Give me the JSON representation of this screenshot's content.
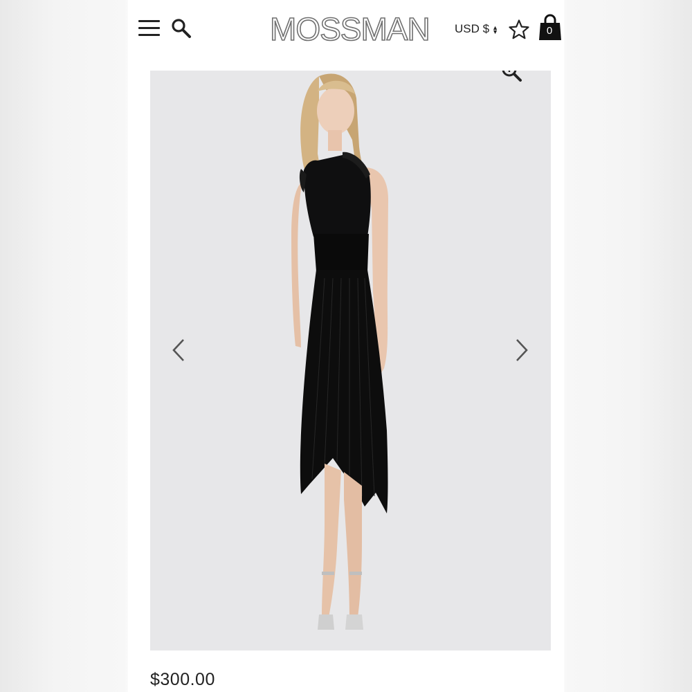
{
  "header": {
    "brand": "MOSSMAN",
    "currency_label": "USD $",
    "cart_count": "0",
    "icons": [
      "menu-icon",
      "search-icon",
      "star-icon",
      "bag-icon"
    ]
  },
  "gallery": {
    "icons": [
      "zoom-icon",
      "chevron-left-icon",
      "chevron-right-icon"
    ],
    "image_alt": "Model wearing black one-shoulder pleated midi dress"
  },
  "product": {
    "price": "$300.00"
  },
  "colors": {
    "text": "#222222",
    "logo_stroke": "#6f6f6f",
    "gallery_bg": "#e7e7e9",
    "dress": "#0d0d0d"
  }
}
